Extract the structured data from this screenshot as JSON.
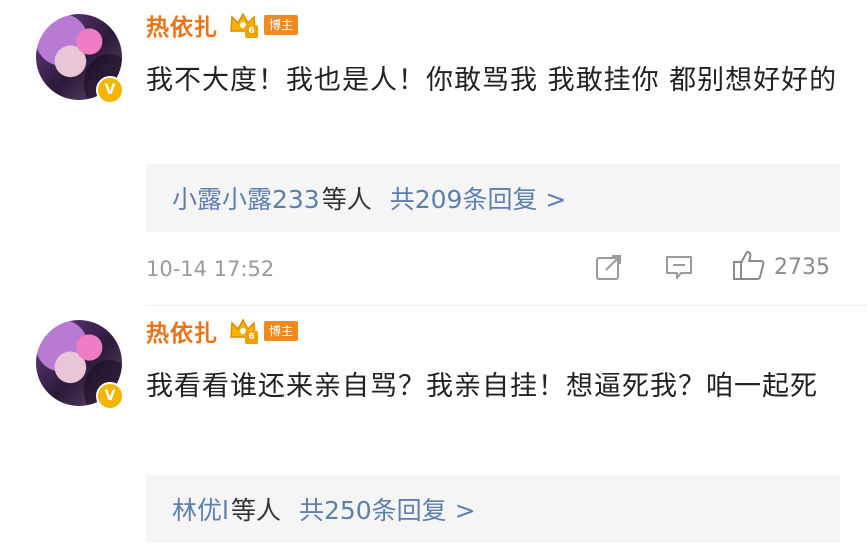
{
  "comments": [
    {
      "author": "热依扎",
      "level": "6",
      "badge": "博主",
      "verified": "V",
      "content": "我不大度！我也是人！你敢骂我 我敢挂你 都别想好好的",
      "reply_users": "小露小露233",
      "reply_mid": "等人",
      "reply_total": "共209条回复 >",
      "time": "10-14 17:52",
      "likes": "2735"
    },
    {
      "author": "热依扎",
      "level": "6",
      "badge": "博主",
      "verified": "V",
      "content": "我看看谁还来亲自骂？我亲自挂！想逼死我？咱一起死",
      "reply_users": "林优l",
      "reply_mid": "等人",
      "reply_total": "共250条回复 >"
    }
  ],
  "icons": {
    "accent": "#ea7317",
    "link": "#5d7fb0",
    "verified": "#f4b400",
    "share": "share-icon",
    "comment": "comment-icon",
    "like": "like-icon",
    "crown": "crown-icon"
  }
}
